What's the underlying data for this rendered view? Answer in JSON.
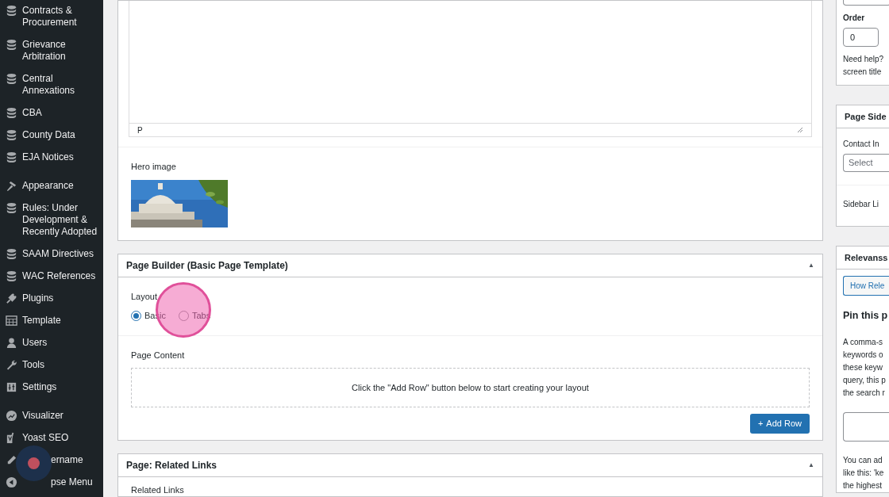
{
  "sidebar": {
    "items": [
      {
        "label": "Contracts & Procurement",
        "kind": "database",
        "gap_before": false,
        "covered": false
      },
      {
        "label": "Grievance Arbitration",
        "kind": "database",
        "gap_before": false,
        "covered": false
      },
      {
        "label": "Central Annexations",
        "kind": "database",
        "gap_before": false,
        "covered": false
      },
      {
        "label": "CBA",
        "kind": "database",
        "gap_before": false,
        "covered": false
      },
      {
        "label": "County Data",
        "kind": "database",
        "gap_before": false,
        "covered": false
      },
      {
        "label": "EJA Notices",
        "kind": "database",
        "gap_before": false,
        "covered": false
      },
      {
        "label": "Appearance",
        "kind": "brush",
        "gap_before": true,
        "covered": false
      },
      {
        "label": "Rules: Under Development & Recently Adopted",
        "kind": "database",
        "gap_before": false,
        "covered": false
      },
      {
        "label": "SAAM Directives",
        "kind": "database",
        "gap_before": false,
        "covered": false
      },
      {
        "label": "WAC References",
        "kind": "database",
        "gap_before": false,
        "covered": false
      },
      {
        "label": "Plugins",
        "kind": "plug",
        "gap_before": false,
        "covered": false
      },
      {
        "label": "Template",
        "kind": "template",
        "gap_before": false,
        "covered": false
      },
      {
        "label": "Users",
        "kind": "user",
        "gap_before": false,
        "covered": false
      },
      {
        "label": "Tools",
        "kind": "wrench",
        "gap_before": false,
        "covered": false
      },
      {
        "label": "Settings",
        "kind": "settings",
        "gap_before": false,
        "covered": false
      },
      {
        "label": "Visualizer",
        "kind": "chart",
        "gap_before": true,
        "covered": false
      },
      {
        "label": "Yoast SEO",
        "kind": "yoast",
        "gap_before": false,
        "covered": false
      },
      {
        "label": "ername",
        "kind": "pencil",
        "gap_before": false,
        "covered": true
      },
      {
        "label": "pse Menu",
        "kind": "collapse",
        "gap_before": false,
        "covered": true
      }
    ]
  },
  "editor": {
    "status_path": "P"
  },
  "hero": {
    "label": "Hero image"
  },
  "page_builder": {
    "title": "Page Builder (Basic Page Template)",
    "toggle": "▲",
    "layout_label": "Layout",
    "layout_options": [
      {
        "label": "Basic",
        "selected": true
      },
      {
        "label": "Tabs",
        "selected": false
      }
    ],
    "content_label": "Page Content",
    "empty_message": "Click the \"Add Row\" button below to start creating your layout",
    "add_button": "Add Row",
    "add_icon": "+"
  },
  "related_links": {
    "title": "Page: Related Links",
    "toggle": "▲",
    "label": "Related Links"
  },
  "right": {
    "order_label": "Order",
    "order_value": "0",
    "help_lines": [
      "Need help?",
      "screen title"
    ],
    "sidebar_panel": {
      "title": "Page Side",
      "contact_label": "Contact In",
      "select_placeholder": "Select",
      "links_label": "Sidebar Li"
    },
    "relevanssi": {
      "title": "Relevanss",
      "button": "How Rele",
      "heading": "Pin this p",
      "description_lines": [
        "A comma-s",
        "keywords o",
        "these keyw",
        "query, this p",
        "the search r"
      ],
      "note_lines": [
        "You can ad",
        "like this: 'ke",
        "the highest"
      ]
    }
  }
}
